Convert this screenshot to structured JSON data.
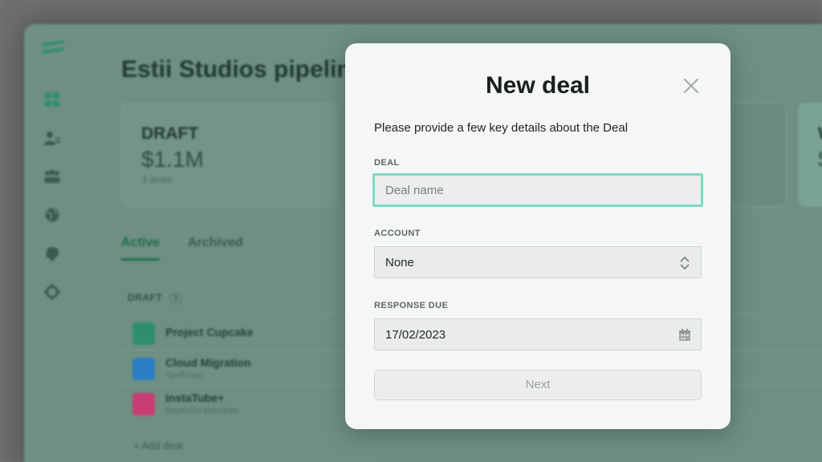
{
  "background": {
    "pipeline_title": "Estii Studios pipeline",
    "sidebar_icons": [
      "grid-icon",
      "user-icon",
      "team-icon",
      "globe-icon",
      "brain-icon",
      "gear-icon"
    ],
    "stats": [
      {
        "label": "DRAFT",
        "amount": "$1.1M",
        "count": "3 deals"
      },
      {
        "label": "W",
        "amount": "$",
        "count": ""
      }
    ],
    "tabs": [
      "Active",
      "Archived"
    ],
    "section": {
      "label": "DRAFT",
      "count": "3"
    },
    "deals": [
      {
        "name": "Project Cupcake",
        "account": "",
        "color": "#2e8f6f"
      },
      {
        "name": "Cloud Migration",
        "account": "Tyrell Corp",
        "color": "#2a7fc4"
      },
      {
        "name": "InstaTube+",
        "account": "Reynholm Industries",
        "color": "#c73d74"
      }
    ],
    "add_deal": "+ Add deal"
  },
  "modal": {
    "title": "New deal",
    "description": "Please provide a few key details about the Deal",
    "deal_label": "DEAL",
    "deal_placeholder": "Deal name",
    "account_label": "ACCOUNT",
    "account_value": "None",
    "response_label": "RESPONSE DUE",
    "response_value": "17/02/2023",
    "next_label": "Next"
  },
  "colors": {
    "accent": "#7fd9c3",
    "brand": "#1f6f50"
  }
}
